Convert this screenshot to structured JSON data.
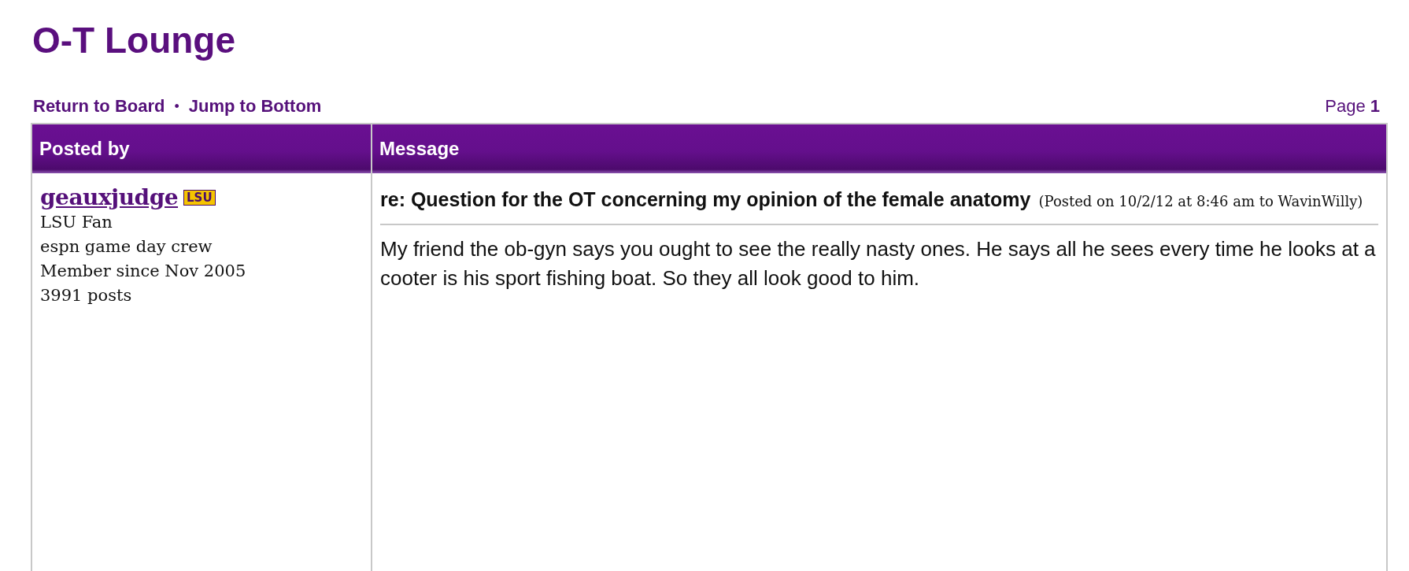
{
  "board_title": "O-T Lounge",
  "nav_links": [
    "Return to Board",
    "Jump to Bottom"
  ],
  "nav_separator": "•",
  "pagination": "Page **1**",
  "table": {
    "columns": [
      "Posted by",
      "Message"
    ]
  },
  "posts": [
    {
      "author": "geauxjudge",
      "badge": "LSU",
      "author_details": [
        "LSU Fan",
        "espn game day crew",
        "Member since Nov 2005",
        "3991 posts"
      ],
      "subject": "re: Question for the OT concerning my opinion of the female anatomy",
      "meta": "(Posted on 10/2/12 at 8:46 am to WavinWilly)",
      "body": "My friend the ob-gyn says you ought to see the really nasty ones. He says all he sees every time he looks at a cooter is his sport fishing boat. So they all look good to him."
    }
  ]
}
